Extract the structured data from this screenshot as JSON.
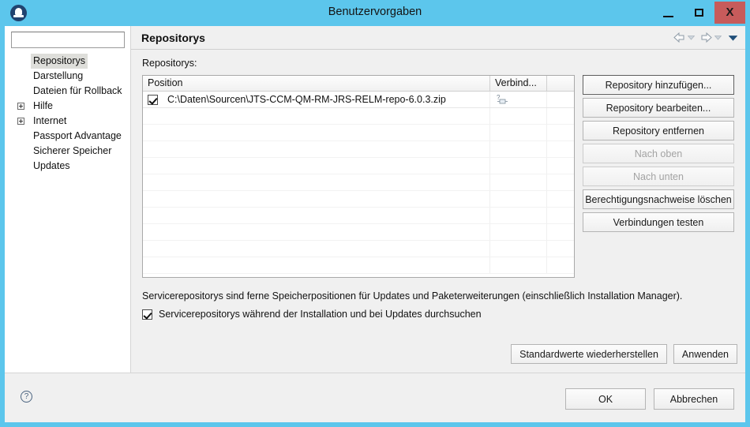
{
  "window": {
    "title": "Benutzervorgaben",
    "app_icon": "installation-manager-icon",
    "controls": {
      "minimize": "minimize-icon",
      "maximize": "maximize-icon",
      "close": "X"
    }
  },
  "sidebar": {
    "filter_value": "",
    "filter_placeholder": "",
    "items": [
      {
        "label": "Repositorys",
        "expandable": false,
        "selected": true
      },
      {
        "label": "Darstellung",
        "expandable": false,
        "selected": false
      },
      {
        "label": "Dateien für Rollback",
        "expandable": false,
        "selected": false
      },
      {
        "label": "Hilfe",
        "expandable": true,
        "selected": false
      },
      {
        "label": "Internet",
        "expandable": true,
        "selected": false
      },
      {
        "label": "Passport Advantage",
        "expandable": false,
        "selected": false
      },
      {
        "label": "Sicherer Speicher",
        "expandable": false,
        "selected": false
      },
      {
        "label": "Updates",
        "expandable": false,
        "selected": false
      }
    ]
  },
  "content": {
    "title": "Repositorys",
    "nav": {
      "back": "back-arrow-icon",
      "back_menu": "dropdown-icon",
      "forward": "forward-arrow-icon",
      "forward_menu": "dropdown-icon",
      "view_menu": "view-menu-icon"
    },
    "field_label": "Repositorys:",
    "table": {
      "columns": [
        "Position",
        "Verbind...",
        ""
      ],
      "rows": [
        {
          "checked": true,
          "position": "C:\\Daten\\Sourcen\\JTS-CCM-QM-RM-JRS-RELM-repo-6.0.3.zip",
          "connection_icon": "connection-unknown-icon"
        }
      ],
      "empty_rows": 10
    },
    "side_buttons": [
      {
        "label": "Repository hinzufügen...",
        "enabled": true,
        "focused": true
      },
      {
        "label": "Repository bearbeiten...",
        "enabled": true,
        "focused": false
      },
      {
        "label": "Repository entfernen",
        "enabled": true,
        "focused": false
      },
      {
        "label": "Nach oben",
        "enabled": false,
        "focused": false
      },
      {
        "label": "Nach unten",
        "enabled": false,
        "focused": false
      },
      {
        "label": "Berechtigungsnachweise löschen",
        "enabled": true,
        "focused": false
      },
      {
        "label": "Verbindungen testen",
        "enabled": true,
        "focused": false
      }
    ],
    "description": "Servicerepositorys sind ferne Speicherpositionen für Updates und Paketerweiterungen (einschließlich Installation Manager).",
    "option": {
      "checked": true,
      "label": "Servicerepositorys während der Installation und bei Updates durchsuchen"
    },
    "restore_defaults_label": "Standardwerte wiederherstellen",
    "apply_label": "Anwenden"
  },
  "footer": {
    "help_icon": "help-icon",
    "help_glyph": "?",
    "ok_label": "OK",
    "cancel_label": "Abbrechen"
  },
  "colors": {
    "titlebar": "#5cc6ec",
    "close_button": "#c75b5b",
    "panel": "#f0f0f0",
    "selection": "#dededa"
  }
}
